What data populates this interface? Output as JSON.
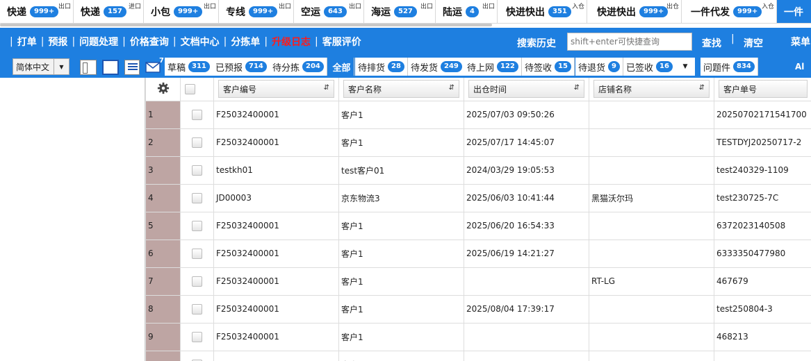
{
  "service_tabs": [
    {
      "label": "快递",
      "badge": "999+",
      "tag": "出口"
    },
    {
      "label": "快递",
      "badge": "157",
      "tag": "进口"
    },
    {
      "label": "小包",
      "badge": "999+",
      "tag": "出口"
    },
    {
      "label": "专线",
      "badge": "999+",
      "tag": "出口"
    },
    {
      "label": "空运",
      "badge": "643",
      "tag": "出口"
    },
    {
      "label": "海运",
      "badge": "527",
      "tag": "出口"
    },
    {
      "label": "陆运",
      "badge": "4",
      "tag": "出口"
    },
    {
      "label": "快进快出",
      "badge": "351",
      "tag": "入仓"
    },
    {
      "label": "快进快出",
      "badge": "999+",
      "tag": "出仓"
    },
    {
      "label": "一件代发",
      "badge": "999+",
      "tag": "入仓"
    },
    {
      "label": "一件",
      "badge": "",
      "tag": ""
    }
  ],
  "nav": {
    "separator": "|",
    "links": [
      "打单",
      "预报",
      "问题处理",
      "价格查询",
      "文档中心",
      "分拣单",
      "升级日志",
      "客服评价"
    ],
    "search_history": "搜索历史",
    "search_placeholder": "shift+enter可快捷查询",
    "find": "查找",
    "bar": "|",
    "clear": "清空",
    "menu": "菜单"
  },
  "status": {
    "language": "简体中文",
    "mail_count": "7",
    "filters": [
      {
        "label": "草稿",
        "count": "311"
      },
      {
        "label": "已预报",
        "count": "714"
      },
      {
        "label": "待分拣",
        "count": "204"
      },
      {
        "label": "全部",
        "count": ""
      },
      {
        "label": "待排货",
        "count": "28"
      },
      {
        "label": "待发货",
        "count": "249"
      },
      {
        "label": "待上网",
        "count": "122"
      },
      {
        "label": "待签收",
        "count": "15"
      },
      {
        "label": "待退货",
        "count": "9"
      },
      {
        "label": "已签收",
        "count": "16"
      }
    ],
    "problem": {
      "label": "问题件",
      "count": "834"
    },
    "all_end": "Al"
  },
  "table": {
    "columns": [
      "客户编号",
      "客户名称",
      "出仓时间",
      "店铺名称",
      "客户单号"
    ],
    "rows": [
      {
        "n": "1",
        "code": "F25032400001",
        "name": "客户1",
        "time": "2025/07/03 09:50:26",
        "shop": "",
        "order": "20250702171541700"
      },
      {
        "n": "2",
        "code": "F25032400001",
        "name": "客户1",
        "time": "2025/07/17 14:45:07",
        "shop": "",
        "order": "TESTDYJ20250717-2"
      },
      {
        "n": "3",
        "code": "testkh01",
        "name": "test客户01",
        "time": "2024/03/29 19:05:53",
        "shop": "",
        "order": "test240329-1109"
      },
      {
        "n": "4",
        "code": "JD00003",
        "name": "京东物流3",
        "time": "2025/06/03 10:41:44",
        "shop": "黑猫沃尔玛",
        "order": "test230725-7C"
      },
      {
        "n": "5",
        "code": "F25032400001",
        "name": "客户1",
        "time": "2025/06/20 16:54:33",
        "shop": "",
        "order": "6372023140508"
      },
      {
        "n": "6",
        "code": "F25032400001",
        "name": "客户1",
        "time": "2025/06/19 14:21:27",
        "shop": "",
        "order": "6333350477980"
      },
      {
        "n": "7",
        "code": "F25032400001",
        "name": "客户1",
        "time": "",
        "shop": "RT-LG",
        "order": "467679"
      },
      {
        "n": "8",
        "code": "F25032400001",
        "name": "客户1",
        "time": "2025/08/04 17:39:17",
        "shop": "",
        "order": "test250804-3"
      },
      {
        "n": "9",
        "code": "F25032400001",
        "name": "客户1",
        "time": "",
        "shop": "",
        "order": "468213"
      },
      {
        "n": "",
        "code": "",
        "name": "客户",
        "time": "",
        "shop": "",
        "order": ""
      }
    ]
  }
}
